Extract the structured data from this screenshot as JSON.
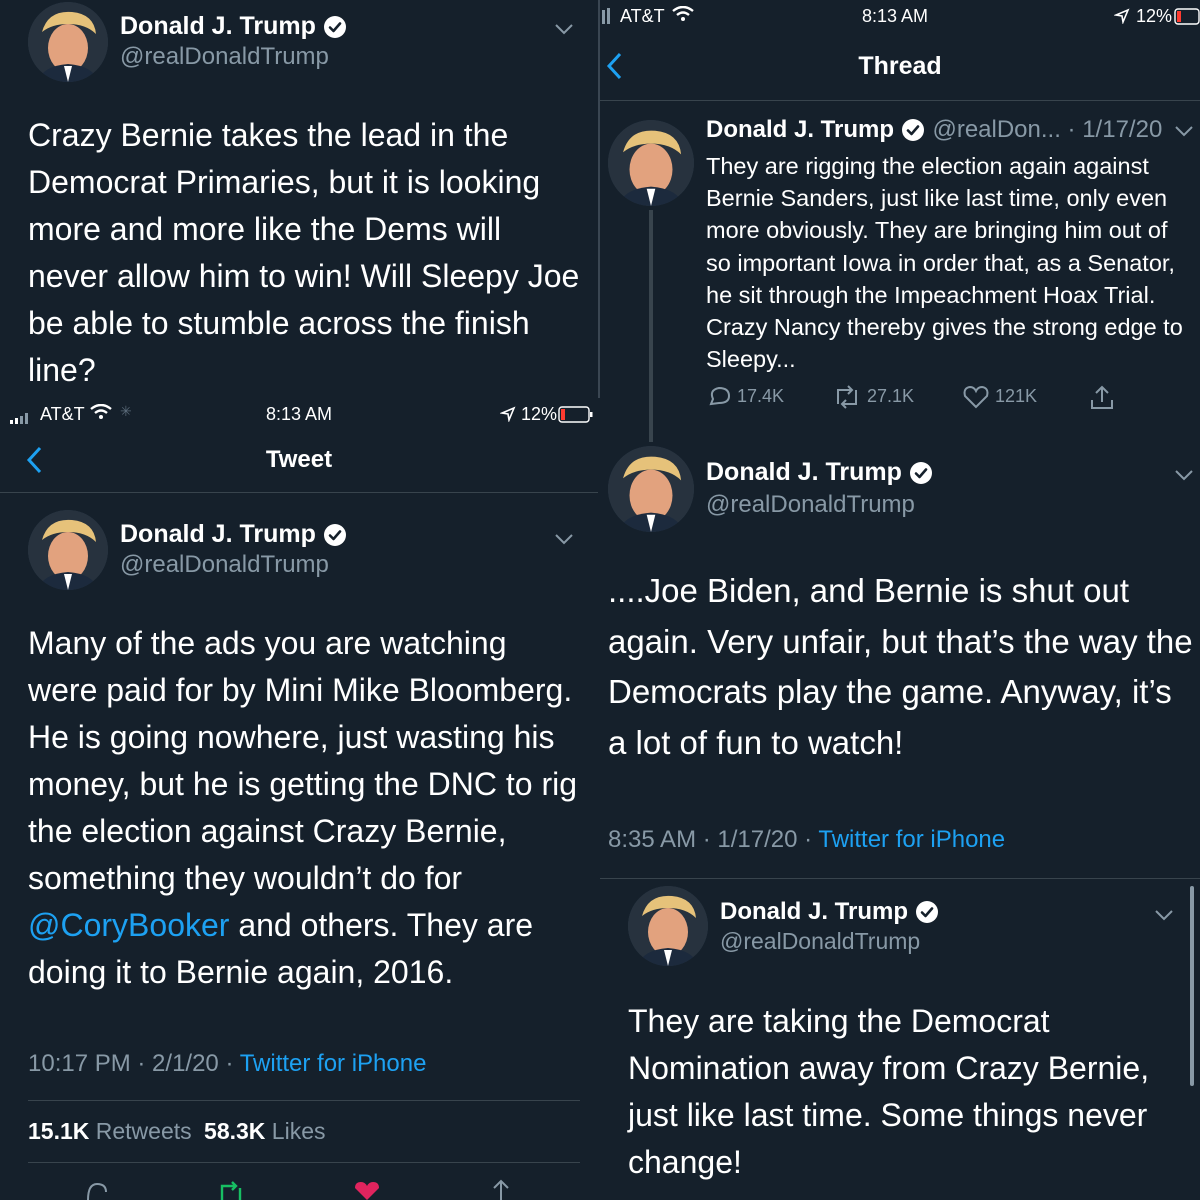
{
  "accent_color": "#1da1f2",
  "background_color": "#15202b",
  "top_left": {
    "author_name": "Donald J. Trump",
    "author_handle": "@realDonaldTrump",
    "text": "Crazy Bernie takes the lead in the Democrat Primaries, but it is looking more and more like the Dems will never allow him to win! Will Sleepy Joe be able to stumble across the finish line?"
  },
  "bottom_left": {
    "status_bar": {
      "carrier": "AT&T",
      "time": "8:13 AM",
      "battery": "12%"
    },
    "nav_title": "Tweet",
    "author_name": "Donald J. Trump",
    "author_handle": "@realDonaldTrump",
    "text_part1": "Many of the ads you are watching were paid for by Mini Mike Bloomberg. He is going nowhere, just wasting his money, but he is getting the DNC to rig the election against Crazy Bernie, something they wouldn’t do for ",
    "mention": "@CoryBooker",
    "text_part2": " and others. They are doing it to Bernie again, 2016.",
    "timestamp": "10:17 PM · 2/1/20 · ",
    "source": "Twitter for iPhone",
    "retweets_count": "15.1K",
    "retweets_label": "Retweets",
    "likes_count": "58.3K",
    "likes_label": "Likes"
  },
  "top_right": {
    "status_bar": {
      "carrier": "AT&T",
      "time": "8:13 AM",
      "battery": "12%"
    },
    "nav_title": "Thread",
    "thread_tweet": {
      "author_name": "Donald J. Trump",
      "author_handle_date": "@realDon... · 1/17/20",
      "text": "They are rigging the election again against Bernie Sanders, just like last time, only even more obviously. They are bringing him out of so important Iowa in order that, as a Senator, he sit through the Impeachment Hoax Trial. Crazy Nancy thereby gives the strong edge to Sleepy...",
      "replies": "17.4K",
      "retweets": "27.1K",
      "likes": "121K"
    },
    "main_tweet": {
      "author_name": "Donald J. Trump",
      "author_handle": "@realDonaldTrump",
      "text": "....Joe Biden, and Bernie is shut out again. Very unfair, but that’s the way the Democrats play the game. Anyway, it’s a lot of fun to watch!",
      "timestamp": "8:35 AM · 1/17/20 · ",
      "source": "Twitter for iPhone"
    }
  },
  "bottom_right": {
    "author_name": "Donald J. Trump",
    "author_handle": "@realDonaldTrump",
    "text": "They are taking the Democrat Nomination away from Crazy Bernie, just like last time. Some things never change!"
  }
}
